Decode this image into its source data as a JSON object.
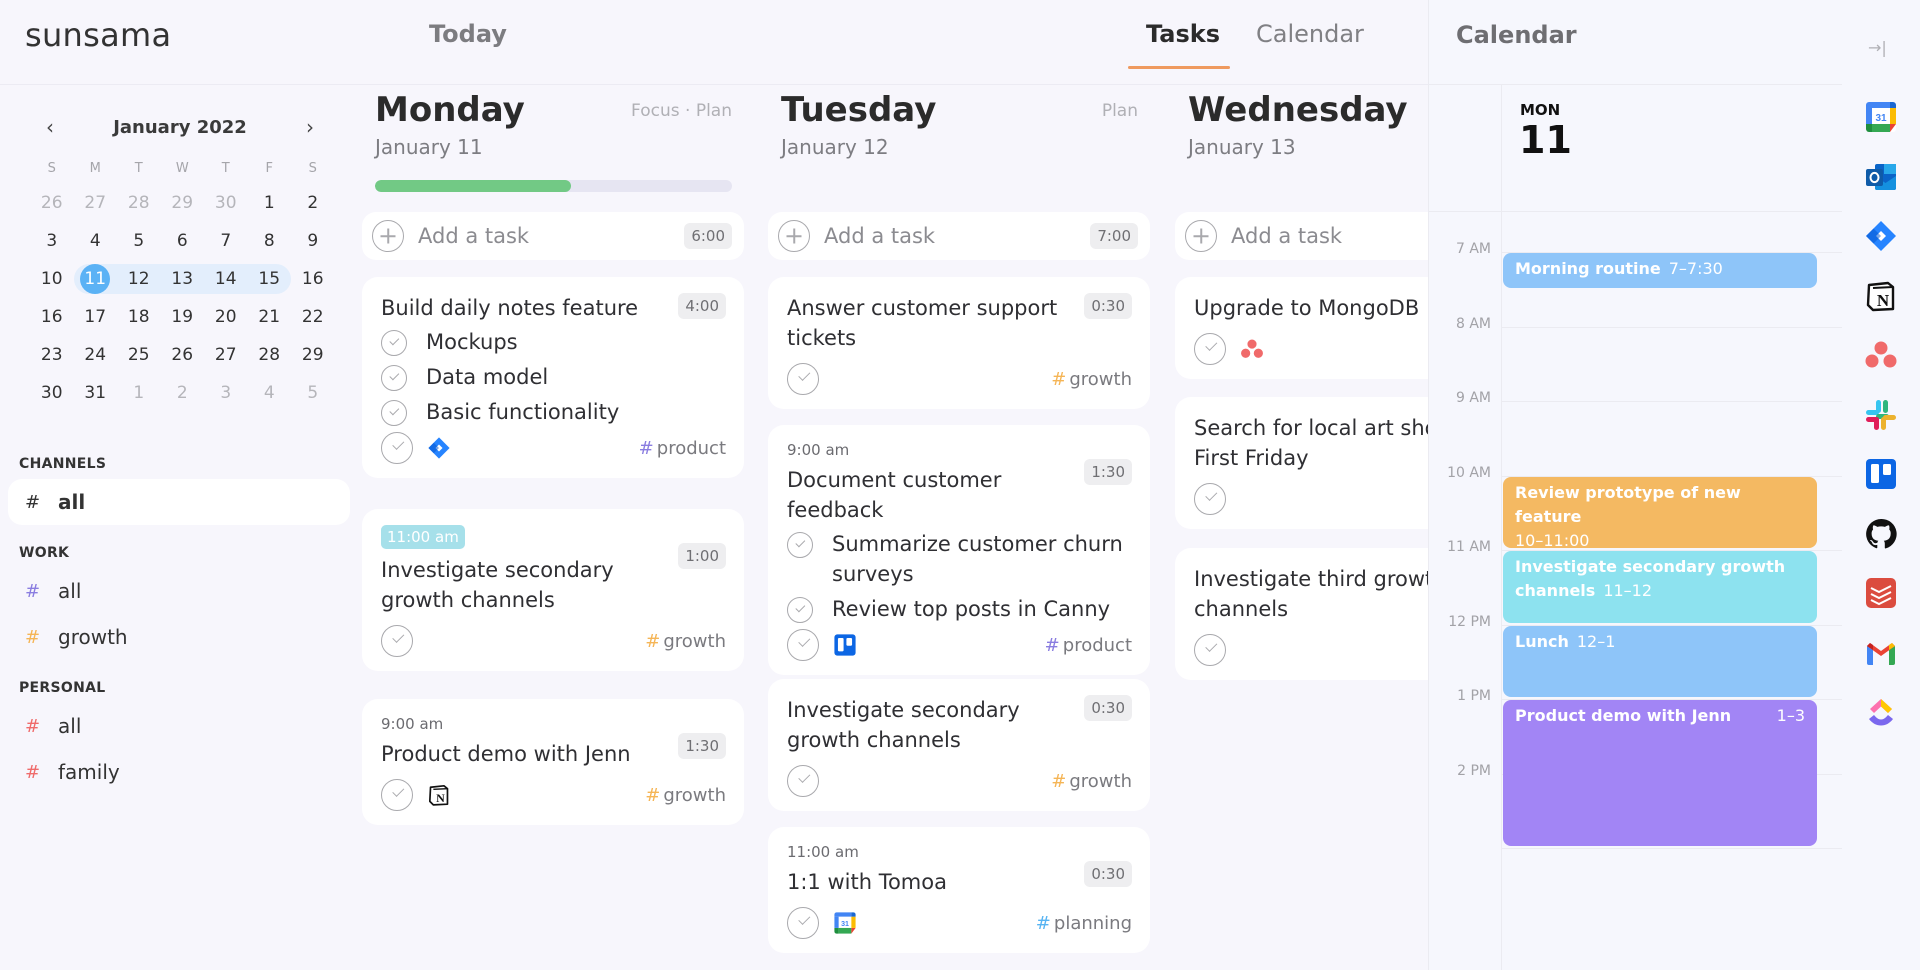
{
  "app": {
    "logo": "sunsama",
    "page_title": "Today"
  },
  "view_tabs": [
    {
      "label": "Tasks",
      "active": true
    },
    {
      "label": "Calendar",
      "active": false
    }
  ],
  "accent_color": "#ef9a5f",
  "mini_calendar": {
    "month_label": "January 2022",
    "prev_icon": "chevron-left-icon",
    "next_icon": "chevron-right-icon",
    "weekdays": [
      "S",
      "M",
      "T",
      "W",
      "T",
      "F",
      "S"
    ],
    "weeks": [
      [
        "26",
        "27",
        "28",
        "29",
        "30",
        "1",
        "2"
      ],
      [
        "3",
        "4",
        "5",
        "6",
        "7",
        "8",
        "9"
      ],
      [
        "10",
        "11",
        "12",
        "13",
        "14",
        "15",
        "16"
      ],
      [
        "16",
        "17",
        "18",
        "19",
        "20",
        "21",
        "22"
      ],
      [
        "23",
        "24",
        "25",
        "26",
        "27",
        "28",
        "29"
      ],
      [
        "30",
        "31",
        "1",
        "2",
        "3",
        "4",
        "5"
      ]
    ],
    "selected_day": "11",
    "highlighted_week_row": 2
  },
  "sidebar": {
    "sections": [
      {
        "title": "CHANNELS",
        "items": [
          {
            "label": "all",
            "hash_color": "#333333",
            "active": true
          }
        ]
      },
      {
        "title": "WORK",
        "items": [
          {
            "label": "all",
            "hash_color": "#8a7de0",
            "active": false
          },
          {
            "label": "growth",
            "hash_color": "#f5b556",
            "active": false
          }
        ]
      },
      {
        "title": "PERSONAL",
        "items": [
          {
            "label": "all",
            "hash_color": "#ef6b6b",
            "active": false
          },
          {
            "label": "family",
            "hash_color": "#ef6b6b",
            "active": false
          }
        ]
      }
    ]
  },
  "tag_colors": {
    "product": "#8a7de0",
    "growth": "#f5b556",
    "planning": "#58b4f2"
  },
  "days": [
    {
      "title": "Monday",
      "date": "January 11",
      "actions": [
        "Focus",
        "Plan"
      ],
      "progress_percent": 55,
      "add_task": {
        "label": "Add a task",
        "total": "6:00"
      },
      "tasks": [
        {
          "time": "",
          "time_chip": false,
          "title": "Build daily notes feature",
          "duration": "4:00",
          "subtasks": [
            "Mockups",
            "Data model",
            "Basic functionality"
          ],
          "integration": "jira-icon",
          "tag": "product"
        },
        {
          "time": "11:00 am",
          "time_chip": true,
          "title": "Investigate secondary growth channels",
          "duration": "1:00",
          "subtasks": [],
          "integration": "",
          "tag": "growth"
        },
        {
          "time": "9:00 am",
          "time_chip": false,
          "title": "Product demo with Jenn",
          "duration": "1:30",
          "subtasks": [],
          "integration": "notion-icon",
          "tag": "growth"
        }
      ]
    },
    {
      "title": "Tuesday",
      "date": "January 12",
      "actions": [
        "Plan"
      ],
      "add_task": {
        "label": "Add a task",
        "total": "7:00"
      },
      "tasks": [
        {
          "time": "",
          "time_chip": false,
          "title": "Answer customer support tickets",
          "duration": "0:30",
          "subtasks": [],
          "integration": "",
          "tag": "growth"
        },
        {
          "time": "9:00 am",
          "time_chip": false,
          "title": "Document customer feedback",
          "duration": "1:30",
          "subtasks": [
            "Summarize customer churn surveys",
            "Review top posts in Canny"
          ],
          "integration": "trello-icon",
          "tag": "product"
        },
        {
          "time": "",
          "time_chip": false,
          "title": "Investigate secondary growth channels",
          "duration": "0:30",
          "subtasks": [],
          "integration": "",
          "tag": "growth"
        },
        {
          "time": "11:00 am",
          "time_chip": false,
          "title": "1:1 with Tomoa",
          "duration": "0:30",
          "subtasks": [],
          "integration": "google-calendar-icon",
          "tag": "planning"
        }
      ]
    },
    {
      "title": "Wednesday",
      "date": "January 13",
      "actions": [],
      "add_task": {
        "label": "Add a task",
        "total": ""
      },
      "tasks": [
        {
          "time": "",
          "time_chip": false,
          "title": "Upgrade to MongoDB",
          "duration": "",
          "subtasks": [],
          "integration": "asana-icon",
          "tag": ""
        },
        {
          "time": "",
          "time_chip": false,
          "title": "Search for local art shows on First Friday",
          "duration": "",
          "subtasks": [],
          "integration": "",
          "tag": ""
        },
        {
          "time": "",
          "time_chip": false,
          "title": "Investigate third growth channels",
          "duration": "",
          "subtasks": [],
          "integration": "",
          "tag": ""
        }
      ]
    }
  ],
  "calendar_panel": {
    "title": "Calendar",
    "day_of_week": "MON",
    "day_number": "11",
    "hours": [
      "7 AM",
      "8 AM",
      "9 AM",
      "10 AM",
      "11 AM",
      "12 PM",
      "1 PM",
      "2 PM"
    ],
    "events": [
      {
        "title": "Morning routine",
        "time": "7–7:30",
        "start": 7,
        "end": 7.5,
        "color": "#8ec5f9",
        "layout": "inline"
      },
      {
        "title": "Review prototype of new feature",
        "time": "10–11:00",
        "start": 10,
        "end": 11,
        "color": "#f4b962",
        "layout": "stacked"
      },
      {
        "title": "Investigate secondary growth channels",
        "time": "11–12",
        "start": 11,
        "end": 12,
        "color": "#8de2ef",
        "layout": "inline"
      },
      {
        "title": "Lunch",
        "time": "12–1",
        "start": 12,
        "end": 13,
        "color": "#8ec5f9",
        "layout": "inline"
      },
      {
        "title": "Product demo with Jenn",
        "time": "1–3",
        "start": 13,
        "end": 15,
        "color": "#a285f5",
        "layout": "split"
      }
    ]
  },
  "integrations_rail": {
    "collapse_icon": "→|",
    "icons": [
      "google-calendar-icon",
      "outlook-icon",
      "jira-icon",
      "notion-icon",
      "asana-icon",
      "slack-icon",
      "trello-icon",
      "github-icon",
      "todoist-icon",
      "gmail-icon",
      "clickup-icon"
    ]
  }
}
